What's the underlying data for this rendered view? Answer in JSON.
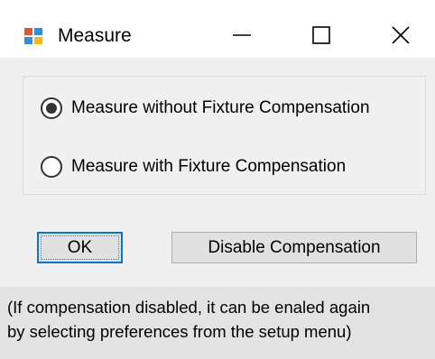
{
  "window": {
    "title": "Measure",
    "icon": "app-window-icon",
    "controls": {
      "minimize_icon": "minimize-icon",
      "maximize_icon": "maximize-icon",
      "close_icon": "close-icon"
    }
  },
  "options": {
    "selected": "without",
    "items": [
      {
        "label": "Measure without Fixture Compensation",
        "checked": true
      },
      {
        "label": "Measure with Fixture Compensation",
        "checked": false
      }
    ]
  },
  "buttons": {
    "ok_label": "OK",
    "disable_label": "Disable Compensation"
  },
  "footer": {
    "line1": "(If compensation disabled, it can be enaled again",
    "line2": "by selecting preferences from the setup menu)"
  },
  "colors": {
    "focus_border": "#0078d7",
    "window_bg": "#f0f0f0",
    "footer_bg": "#e3e3e3"
  }
}
